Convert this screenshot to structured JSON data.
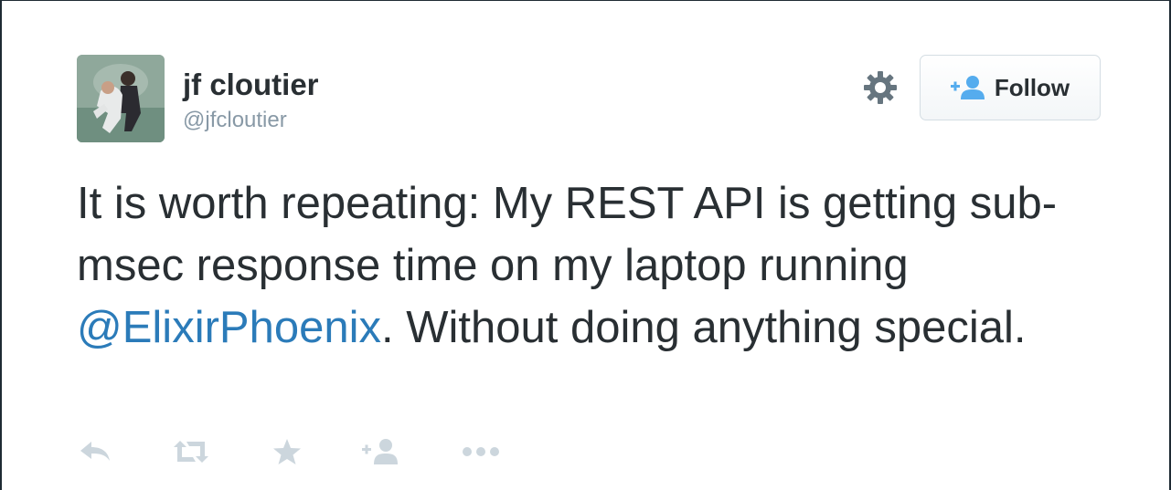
{
  "user": {
    "name": "jf cloutier",
    "handle": "@jfcloutier",
    "avatar_icon": "avatar-photo"
  },
  "header": {
    "settings_icon": "gear-icon",
    "follow_label": "Follow",
    "follow_icon": "add-user-icon"
  },
  "tweet": {
    "text_before": "It is worth repeating: My REST API is getting sub-msec response time on my laptop running ",
    "mention": "@ElixirPhoenix",
    "text_after": ". Without doing anything special."
  },
  "actions": [
    {
      "name": "reply",
      "icon": "reply-icon"
    },
    {
      "name": "retweet",
      "icon": "retweet-icon"
    },
    {
      "name": "favorite",
      "icon": "star-icon"
    },
    {
      "name": "follow",
      "icon": "add-user-icon"
    },
    {
      "name": "more",
      "icon": "more-icon"
    }
  ],
  "colors": {
    "text": "#292f33",
    "secondary": "#8899a6",
    "link": "#2b7bb9",
    "action_icon": "#ccd6dd",
    "follow_icon": "#55acee"
  }
}
